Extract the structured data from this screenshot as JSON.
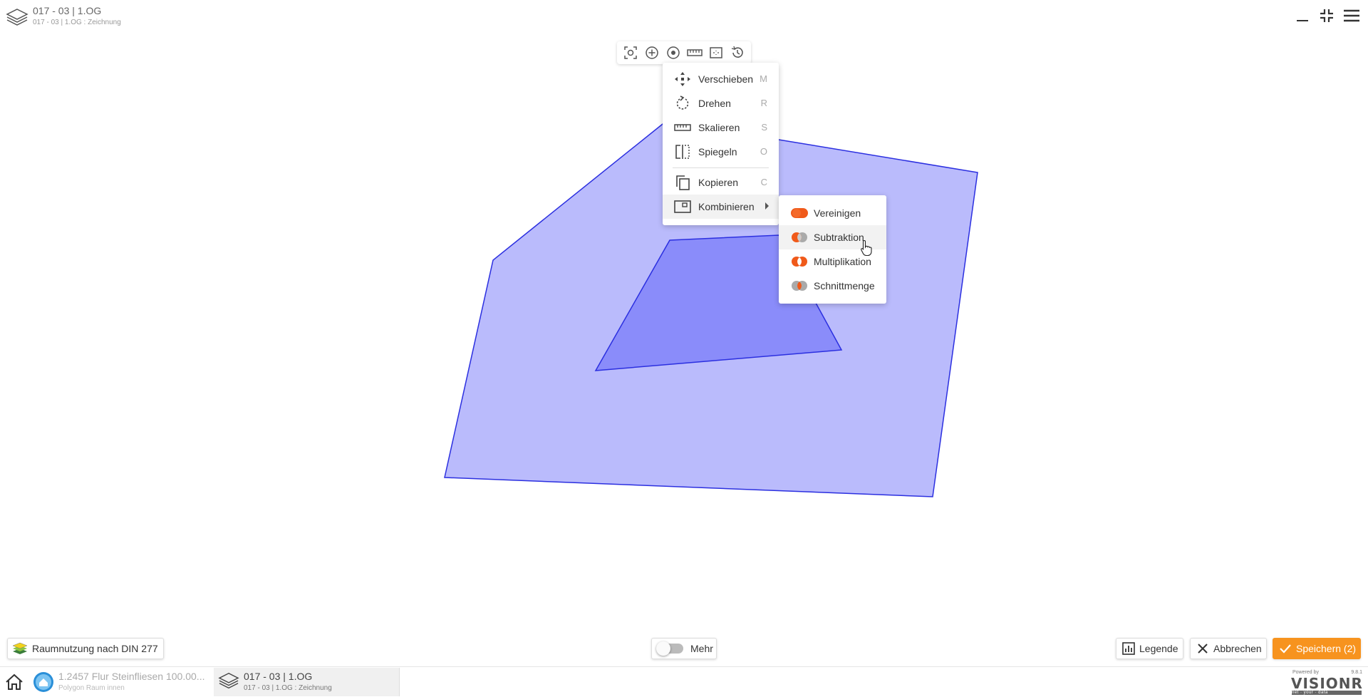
{
  "header": {
    "title": "017 - 03 | 1.OG",
    "subtitle": "017 - 03 | 1.OG : Zeichnung",
    "layers_icon": "layers-icon",
    "window_controls": [
      "minimize-icon",
      "collapse-icon",
      "menu-icon"
    ]
  },
  "toolbar": {
    "buttons": [
      "screenshot-icon",
      "add-circle-icon",
      "target-icon",
      "ruler-icon",
      "area-select-icon",
      "history-icon"
    ]
  },
  "main_menu": {
    "items": [
      {
        "label": "Verschieben",
        "key": "M",
        "icon": "move-icon"
      },
      {
        "label": "Drehen",
        "key": "R",
        "icon": "rotate-icon"
      },
      {
        "label": "Skalieren",
        "key": "S",
        "icon": "scale-icon"
      },
      {
        "label": "Spiegeln",
        "key": "O",
        "icon": "mirror-icon"
      },
      {
        "label": "Kopieren",
        "key": "C",
        "icon": "copy-icon"
      },
      {
        "label": "Kombinieren",
        "key": "",
        "icon": "combine-icon"
      }
    ]
  },
  "sub_menu": {
    "items": [
      {
        "label": "Vereinigen",
        "icon": "union-icon"
      },
      {
        "label": "Subtraktion",
        "icon": "subtraction-icon"
      },
      {
        "label": "Multiplikation",
        "icon": "multiplication-icon"
      },
      {
        "label": "Schnittmenge",
        "icon": "intersection-icon"
      }
    ]
  },
  "bottom": {
    "layer_button": "Raumnutzung nach DIN 277",
    "mehr_label": "Mehr",
    "legend_label": "Legende",
    "cancel_label": "Abbrechen",
    "save_label": "Speichern (2)"
  },
  "taskbar": {
    "task1_title": "1.2457 Flur Steinfliesen 100.00...",
    "task1_sub": "Polygon Raum innen",
    "task2_title": "017 - 03 | 1.OG",
    "task2_sub": "017 - 03 | 1.OG : Zeichnung"
  },
  "brand": {
    "powered_by": "Powered by",
    "version": "9.8.1",
    "logo": "VISIONR",
    "tagline": "net · your · data"
  },
  "colors": {
    "polygon_outer_fill": "#babbfc",
    "polygon_inner_fill": "#8a8cfa",
    "polygon_stroke": "#2b2fe0",
    "accent": "#f7931e",
    "combine_orange": "#f05a1a"
  }
}
